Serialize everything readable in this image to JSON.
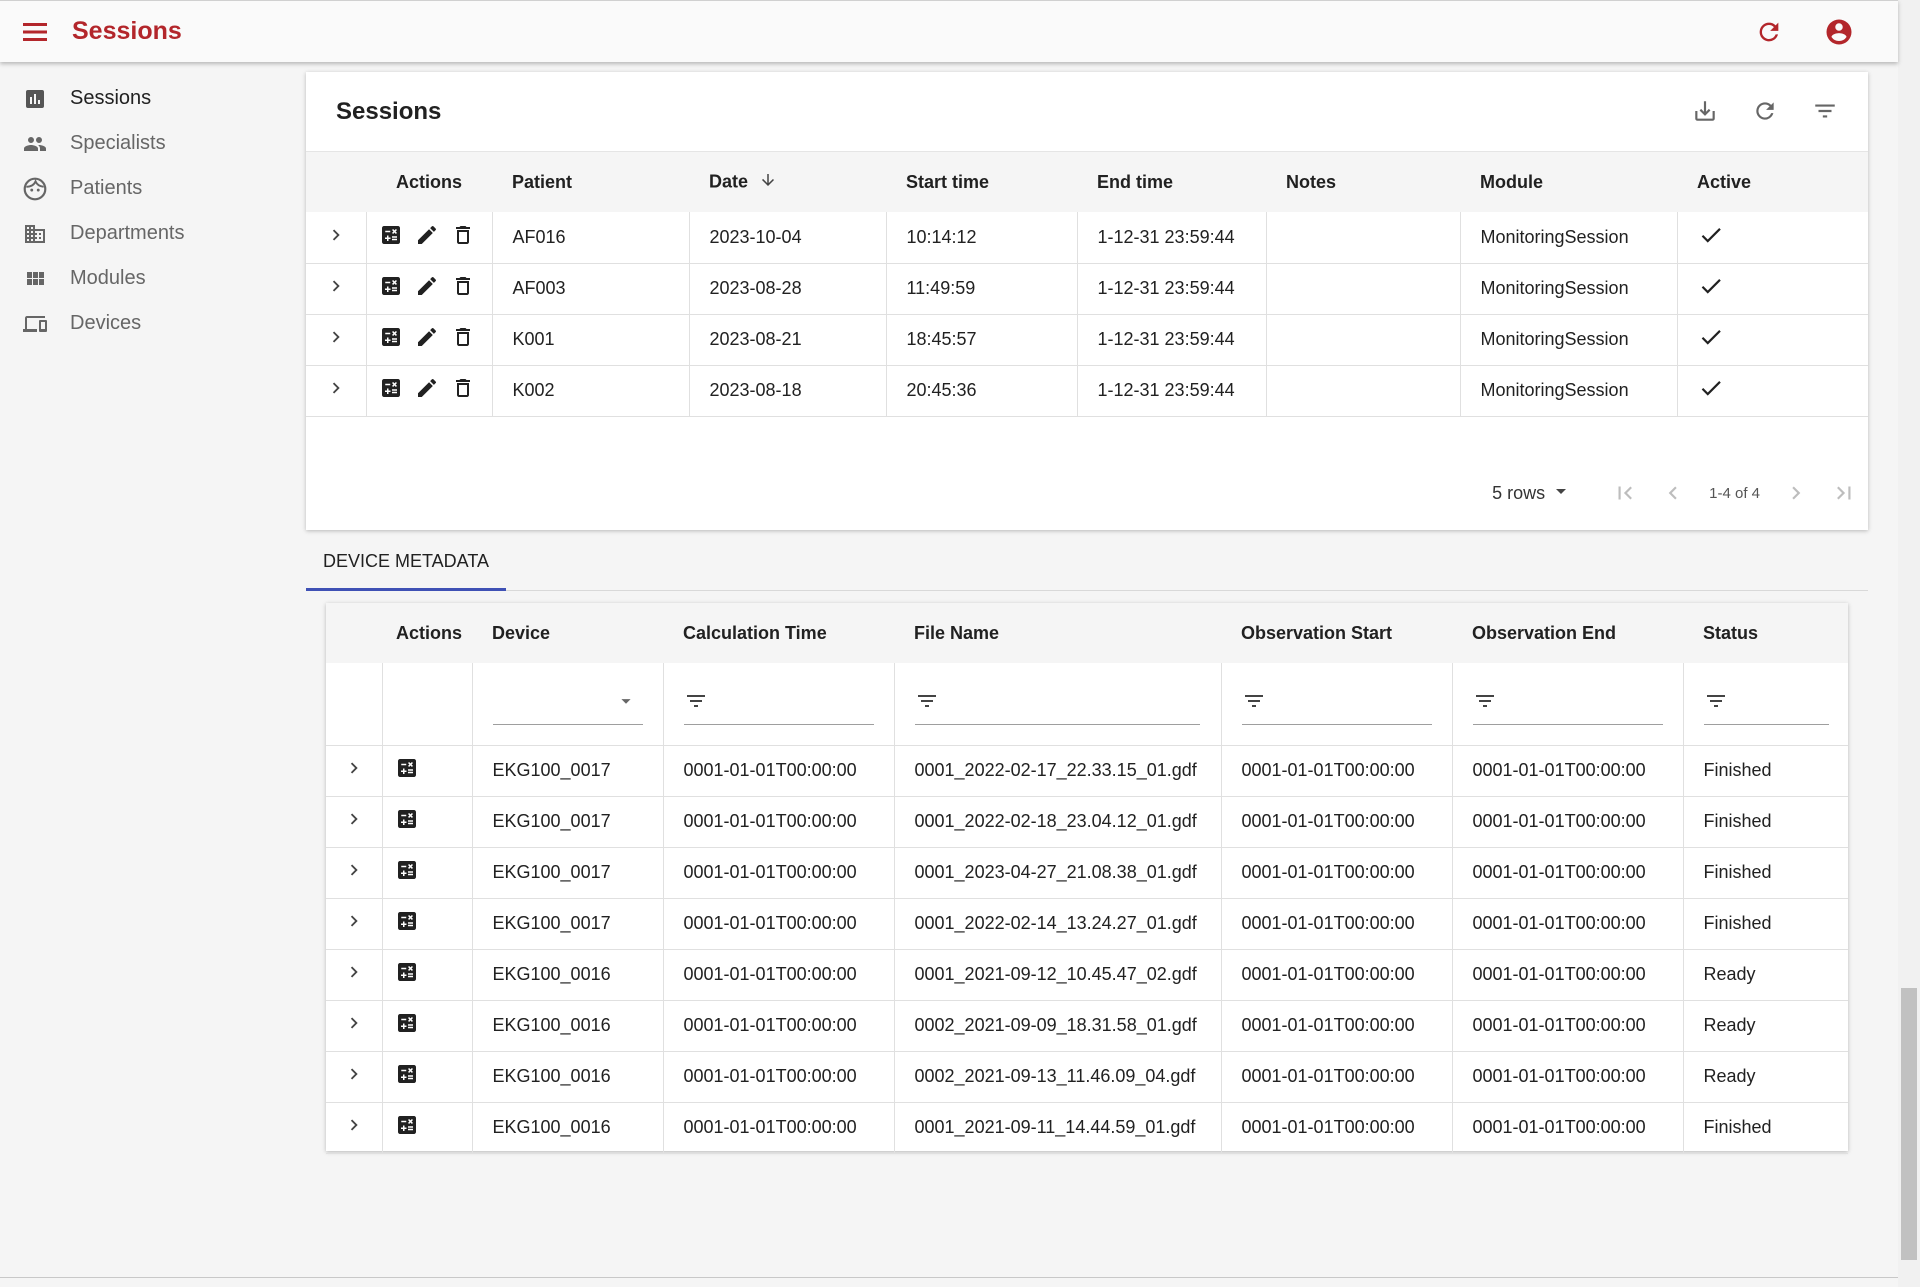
{
  "app": {
    "title": "Sessions",
    "brand_color": "#b3262b",
    "menu_icon": "menu-icon",
    "refresh_icon": "refresh-icon",
    "account_icon": "account-circle-icon"
  },
  "sidebar": {
    "items": [
      {
        "label": "Sessions",
        "icon": "bar-chart-icon",
        "active": true
      },
      {
        "label": "Specialists",
        "icon": "people-icon",
        "active": false
      },
      {
        "label": "Patients",
        "icon": "face-icon",
        "active": false
      },
      {
        "label": "Departments",
        "icon": "building-icon",
        "active": false
      },
      {
        "label": "Modules",
        "icon": "grid-icon",
        "active": false
      },
      {
        "label": "Devices",
        "icon": "devices-icon",
        "active": false
      }
    ]
  },
  "sessions": {
    "title": "Sessions",
    "columns": [
      "Actions",
      "Patient",
      "Date",
      "Start time",
      "End time",
      "Notes",
      "Module",
      "Active"
    ],
    "rows": [
      {
        "patient": "AF016",
        "date": "2023-10-04",
        "start": "10:14:12",
        "end": "1-12-31 23:59:44",
        "notes": "",
        "module": "MonitoringSession",
        "active": true
      },
      {
        "patient": "AF003",
        "date": "2023-08-28",
        "start": "11:49:59",
        "end": "1-12-31 23:59:44",
        "notes": "",
        "module": "MonitoringSession",
        "active": true
      },
      {
        "patient": "K001",
        "date": "2023-08-21",
        "start": "18:45:57",
        "end": "1-12-31 23:59:44",
        "notes": "",
        "module": "MonitoringSession",
        "active": true
      },
      {
        "patient": "K002",
        "date": "2023-08-18",
        "start": "20:45:36",
        "end": "1-12-31 23:59:44",
        "notes": "",
        "module": "MonitoringSession",
        "active": true
      }
    ],
    "pager": {
      "rows_label": "5 rows",
      "range": "1-4 of 4"
    }
  },
  "tabs": {
    "device_metadata": "DEVICE METADATA",
    "accent": "#3f51b5"
  },
  "device_metadata": {
    "columns": [
      "Actions",
      "Device",
      "Calculation Time",
      "File Name",
      "Observation Start",
      "Observation End",
      "Status"
    ],
    "rows": [
      {
        "device": "EKG100_0017",
        "calc": "0001-01-01T00:00:00",
        "file": "0001_2022-02-17_22.33.15_01.gdf",
        "obs_start": "0001-01-01T00:00:00",
        "obs_end": "0001-01-01T00:00:00",
        "status": "Finished"
      },
      {
        "device": "EKG100_0017",
        "calc": "0001-01-01T00:00:00",
        "file": "0001_2022-02-18_23.04.12_01.gdf",
        "obs_start": "0001-01-01T00:00:00",
        "obs_end": "0001-01-01T00:00:00",
        "status": "Finished"
      },
      {
        "device": "EKG100_0017",
        "calc": "0001-01-01T00:00:00",
        "file": "0001_2023-04-27_21.08.38_01.gdf",
        "obs_start": "0001-01-01T00:00:00",
        "obs_end": "0001-01-01T00:00:00",
        "status": "Finished"
      },
      {
        "device": "EKG100_0017",
        "calc": "0001-01-01T00:00:00",
        "file": "0001_2022-02-14_13.24.27_01.gdf",
        "obs_start": "0001-01-01T00:00:00",
        "obs_end": "0001-01-01T00:00:00",
        "status": "Finished"
      },
      {
        "device": "EKG100_0016",
        "calc": "0001-01-01T00:00:00",
        "file": "0001_2021-09-12_10.45.47_02.gdf",
        "obs_start": "0001-01-01T00:00:00",
        "obs_end": "0001-01-01T00:00:00",
        "status": "Ready"
      },
      {
        "device": "EKG100_0016",
        "calc": "0001-01-01T00:00:00",
        "file": "0002_2021-09-09_18.31.58_01.gdf",
        "obs_start": "0001-01-01T00:00:00",
        "obs_end": "0001-01-01T00:00:00",
        "status": "Ready"
      },
      {
        "device": "EKG100_0016",
        "calc": "0001-01-01T00:00:00",
        "file": "0002_2021-09-13_11.46.09_04.gdf",
        "obs_start": "0001-01-01T00:00:00",
        "obs_end": "0001-01-01T00:00:00",
        "status": "Ready"
      },
      {
        "device": "EKG100_0016",
        "calc": "0001-01-01T00:00:00",
        "file": "0001_2021-09-11_14.44.59_01.gdf",
        "obs_start": "0001-01-01T00:00:00",
        "obs_end": "0001-01-01T00:00:00",
        "status": "Finished"
      }
    ]
  }
}
